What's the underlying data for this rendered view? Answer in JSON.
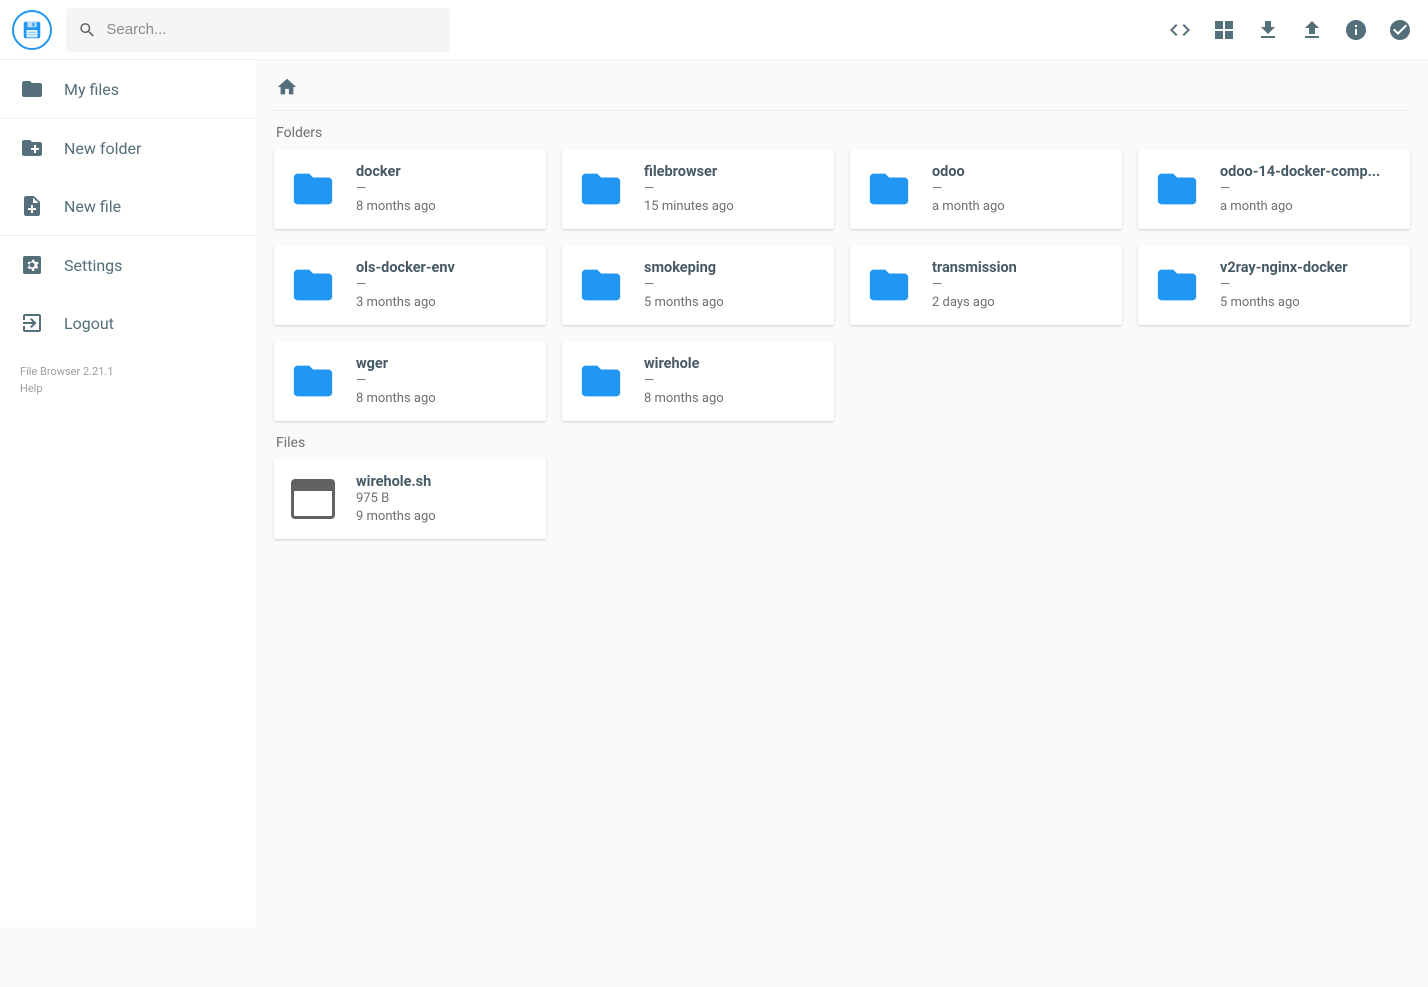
{
  "search": {
    "placeholder": "Search..."
  },
  "sidebar": {
    "my_files": "My files",
    "new_folder": "New folder",
    "new_file": "New file",
    "settings": "Settings",
    "logout": "Logout",
    "version_line": "File Browser 2.21.1",
    "help": "Help"
  },
  "sections": {
    "folders": "Folders",
    "files": "Files"
  },
  "folders": [
    {
      "name": "docker",
      "size": "—",
      "time": "8 months ago"
    },
    {
      "name": "filebrowser",
      "size": "—",
      "time": "15 minutes ago"
    },
    {
      "name": "odoo",
      "size": "—",
      "time": "a month ago"
    },
    {
      "name": "odoo-14-docker-comp...",
      "size": "—",
      "time": "a month ago"
    },
    {
      "name": "ols-docker-env",
      "size": "—",
      "time": "3 months ago"
    },
    {
      "name": "smokeping",
      "size": "—",
      "time": "5 months ago"
    },
    {
      "name": "transmission",
      "size": "—",
      "time": "2 days ago"
    },
    {
      "name": "v2ray-nginx-docker",
      "size": "—",
      "time": "5 months ago"
    },
    {
      "name": "wger",
      "size": "—",
      "time": "8 months ago"
    },
    {
      "name": "wirehole",
      "size": "—",
      "time": "8 months ago"
    }
  ],
  "files": [
    {
      "name": "wirehole.sh",
      "size": "975 B",
      "time": "9 months ago"
    }
  ]
}
